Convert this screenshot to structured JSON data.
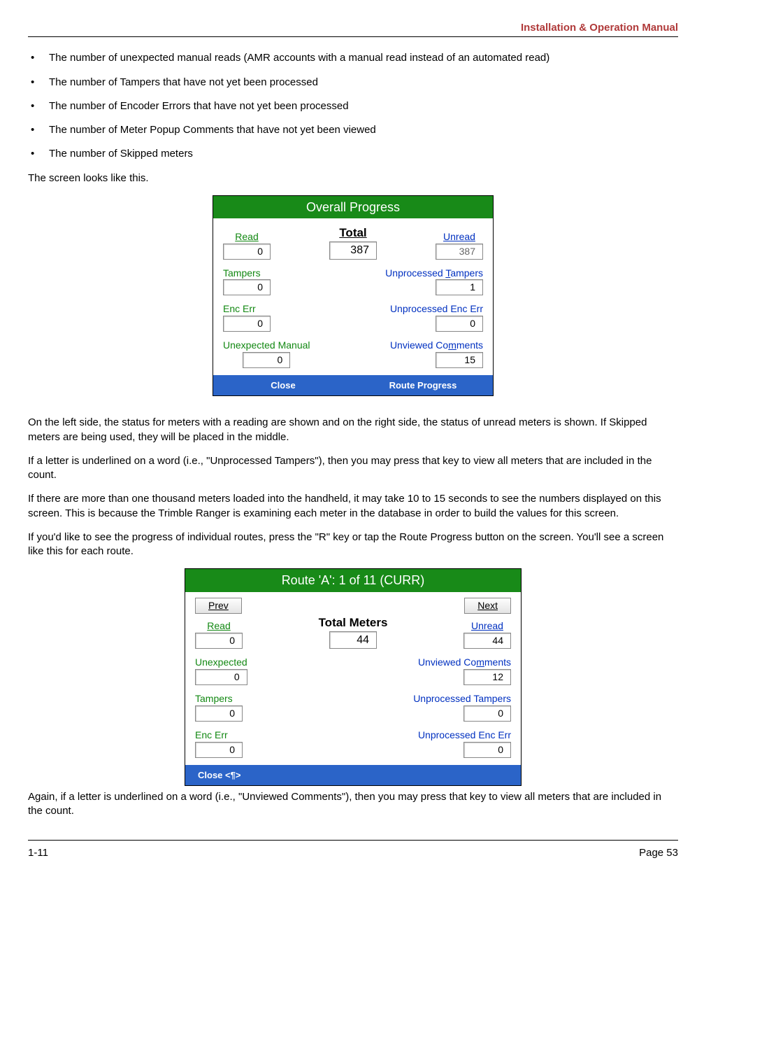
{
  "header": {
    "title": "Installation & Operation Manual"
  },
  "bullets": [
    "The number of unexpected manual reads (AMR accounts with a manual read instead of an automated read)",
    "The number of Tampers that have not yet been processed",
    "The number of Encoder Errors that have not yet been processed",
    "The number of Meter Popup Comments that have not yet been viewed",
    "The number of Skipped meters"
  ],
  "para1": "The screen looks like this.",
  "screenshot1": {
    "title": "Overall Progress",
    "read_label": "Read",
    "read_value": "0",
    "total_label": "Total",
    "total_value": "387",
    "unread_label": "Unread",
    "unread_value": "387",
    "rows": [
      {
        "left_label": "Tampers",
        "left_value": "0",
        "right_label_pre": "Unprocessed ",
        "right_label_u": "T",
        "right_label_post": "ampers",
        "right_value": "1"
      },
      {
        "left_label": "Enc Err",
        "left_value": "0",
        "right_label_pre": "Unprocessed Enc Err",
        "right_label_u": "",
        "right_label_post": "",
        "right_value": "0"
      },
      {
        "left_label": "Unexpected Manual",
        "left_value": "0",
        "right_label_pre": "Unviewed Co",
        "right_label_u": "m",
        "right_label_post": "ments",
        "right_value": "15"
      }
    ],
    "btn_close": "Close",
    "btn_route": "Route Progress"
  },
  "para2": "On the left side, the status for meters with a reading are shown and on the right side, the status of unread meters is shown.  If Skipped meters are being used, they will be placed in the middle.",
  "para3": "If a letter is underlined on a word (i.e., \"Unprocessed Tampers\"), then you may press that key to view all meters that are included in the count.",
  "para4": "If there are more than one thousand meters loaded into the handheld, it may take 10 to 15 seconds to see the numbers displayed on this screen.  This is because the Trimble Ranger is examining each meter in the database in order to build the values for this screen.",
  "para5": "If you'd like to see the progress of individual routes, press the \"R\" key or tap the Route Progress button on the screen.  You'll see a screen like this for each route.",
  "screenshot2": {
    "title": "Route 'A': 1 of 11 (CURR)",
    "prev": "Prev",
    "next": "Next",
    "read_label": "Read",
    "read_value": "0",
    "total_label": "Total Meters",
    "total_value": "44",
    "unread_label": "Unread",
    "unread_value": "44",
    "rows": [
      {
        "left_label": "Unexpected",
        "left_value": "0",
        "right_label_pre": "Unviewed Co",
        "right_label_u": "m",
        "right_label_post": "ments",
        "right_value": "12"
      },
      {
        "left_label": "Tampers",
        "left_value": "0",
        "right_label_pre": "Unprocessed Tampers",
        "right_label_u": "",
        "right_label_post": "",
        "right_value": "0"
      },
      {
        "left_label": "Enc Err",
        "left_value": "0",
        "right_label_pre": "Unprocessed Enc Err",
        "right_label_u": "",
        "right_label_post": "",
        "right_value": "0"
      }
    ],
    "btn_close": "Close <¶>"
  },
  "para6": "Again, if a letter is underlined on a word (i.e., \"Unviewed Comments\"), then you may press that key to view all meters that are included in the count.",
  "footer": {
    "left": "1-11",
    "right": "Page 53"
  }
}
